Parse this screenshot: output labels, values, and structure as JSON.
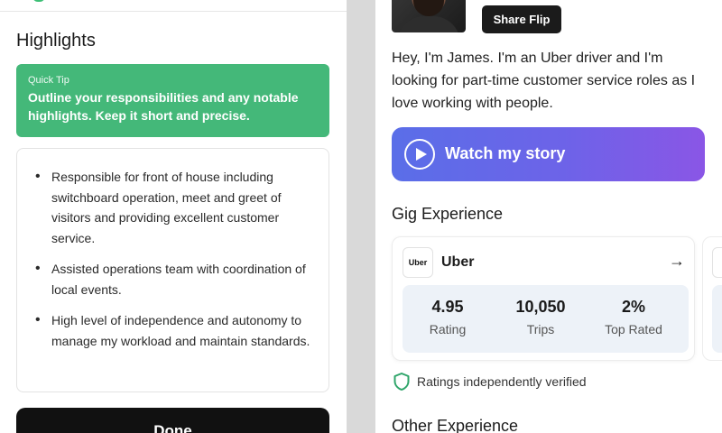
{
  "left": {
    "title": "Highlights",
    "tip": {
      "label": "Quick Tip",
      "text": "Outline your responsibilities and any notable highlights. Keep it short and precise."
    },
    "bullets": [
      "Responsible for front of house including switchboard operation, meet and greet of visitors and providing excellent customer service.",
      "Assisted operations team with coordination of local events.",
      "High level of independence and autonomy to manage my workload and maintain standards."
    ],
    "done_label": "Done"
  },
  "right": {
    "share_label": "Share Flip",
    "bio": "Hey, I'm James. I'm an Uber driver and I'm looking for part-time customer service roles as I love working with people.",
    "watch_label": "Watch my story",
    "gig_title": "Gig Experience",
    "gig": {
      "logo_text": "Uber",
      "company": "Uber",
      "arrow": "→",
      "stats": [
        {
          "value": "4.95",
          "label": "Rating"
        },
        {
          "value": "10,050",
          "label": "Trips"
        },
        {
          "value": "2%",
          "label": "Top Rated"
        }
      ]
    },
    "verified_text": "Ratings independently verified",
    "other_title": "Other Experience"
  },
  "colors": {
    "tip_green": "#44b879",
    "accent_blue": "#5a6ee8",
    "accent_purple": "#8a56e6",
    "shield_green": "#2fa56a",
    "stats_bg": "#edf2f8"
  },
  "icons": [
    "play-icon",
    "arrow-right-icon",
    "shield-icon",
    "uber-logo"
  ]
}
